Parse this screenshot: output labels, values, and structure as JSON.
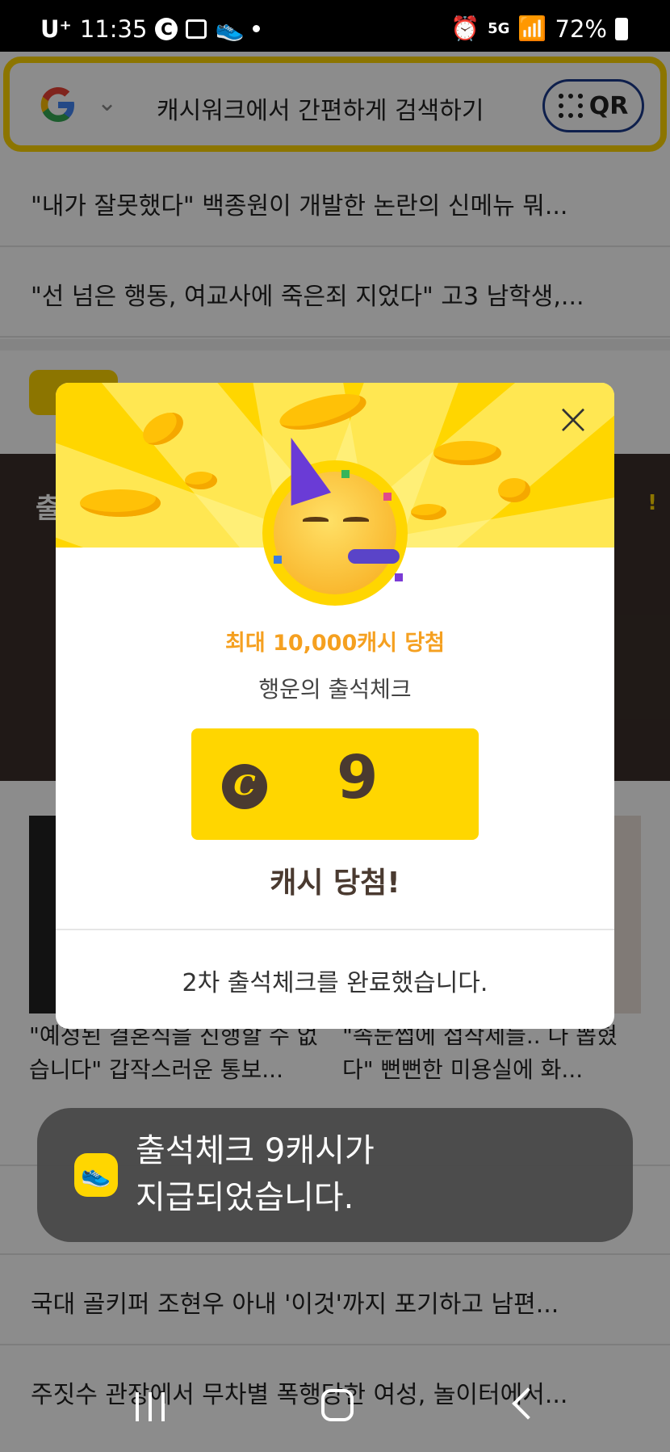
{
  "status_bar": {
    "carrier": "U⁺",
    "time": "11:35",
    "c_icon_label": "C",
    "network": "5G",
    "battery": "72%"
  },
  "search": {
    "placeholder": "캐시워크에서 간편하게 검색하기",
    "qr_label": "QR"
  },
  "news": [
    "\"내가 잘못했다\" 백종원이 개발한 논란의 신메뉴 뭐...",
    "\"선 넘은 행동, 여교사에 죽은죄 지었다\" 고3 남학생,...",
    "국대 골키퍼 조현우 아내 '이것'까지 포기하고 남편...",
    "주짓수 관장에서 무차별 폭행당한 여성, 놀이터에서..."
  ],
  "captions": {
    "left": "\"예정된 결혼식을 진행할 수 없습니다\" 갑작스러운 통보...",
    "right": "\"속눈썹에 접착제들.. 다 뽑혔다\" 뻔뻔한 미용실에 화..."
  },
  "banner": {
    "title": "출",
    "accent": "!"
  },
  "modal": {
    "prize_title": "최대 10,000캐시 당첨",
    "prize_sub": "행운의 출석체크",
    "cash_symbol": "C",
    "cash_amount": "9",
    "win_text": "캐시 당첨!",
    "done_text": "2차 출석체크를 완료했습니다."
  },
  "toast": {
    "line1": "출석체크 9캐시가",
    "line2": "지급되었습니다."
  },
  "colors": {
    "brand_yellow": "#ffd600",
    "prize_orange": "#f5a020",
    "brown": "#4a3a30"
  }
}
